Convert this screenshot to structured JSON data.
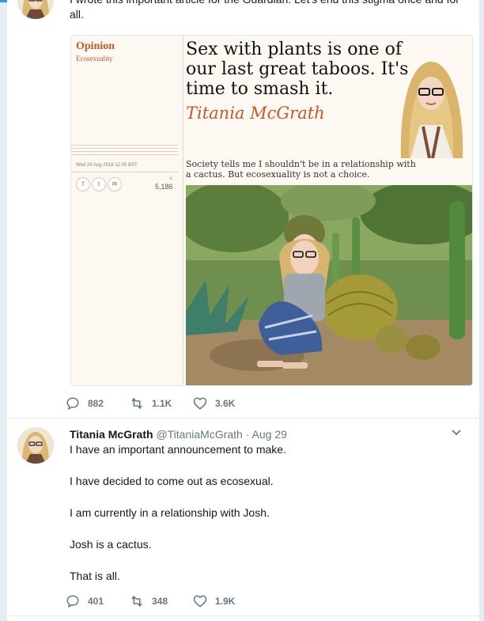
{
  "previous_tweet": {
    "text": "I wrote this important article for the Guardian. Let's end this stigma once and for all.",
    "card": {
      "section": "Opinion",
      "subsection": "Ecosexuality",
      "date": "Wed 29 Aug 2018 12.00 BST",
      "share_count": "5,186",
      "share_icons": [
        "f",
        "t",
        "✉"
      ],
      "headline": "Sex with plants is one of our last great taboos. It's time to smash it.",
      "byline": "Titania McGrath",
      "standfirst": "Society tells me I shouldn't be in a relationship with a cactus. But ecosexuality is not a choice."
    },
    "actions": {
      "replies": "882",
      "retweets": "1.1K",
      "likes": "3.6K"
    }
  },
  "tweet": {
    "name": "Titania McGrath",
    "handle": "@TitaniaMcGrath",
    "separator": "·",
    "date": "Aug 29",
    "paragraphs": [
      "I have an important announcement to make.",
      "I have decided to come out as ecosexual.",
      "I am currently in a relationship with Josh.",
      "Josh is a cactus.",
      "That is all."
    ],
    "actions": {
      "replies": "401",
      "retweets": "348",
      "likes": "1.9K"
    }
  },
  "colors": {
    "accent": "#1da1f2",
    "guardian_opinion": "#c7582a",
    "muted": "#657786"
  }
}
